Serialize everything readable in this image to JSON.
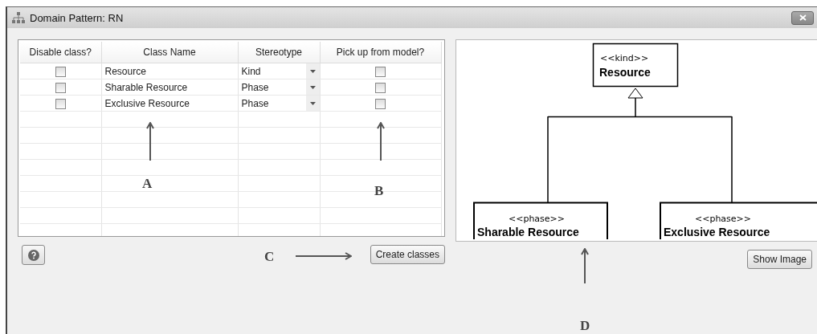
{
  "window": {
    "title": "Domain Pattern: RN"
  },
  "table": {
    "columns": [
      "Disable class?",
      "Class Name",
      "Stereotype",
      "Pick up from model?"
    ],
    "rows": [
      {
        "disable_class": false,
        "class_name": "Resource",
        "stereotype": "Kind",
        "pick_up": false
      },
      {
        "disable_class": false,
        "class_name": "Sharable Resource",
        "stereotype": "Phase",
        "pick_up": false
      },
      {
        "disable_class": false,
        "class_name": "Exclusive Resource",
        "stereotype": "Phase",
        "pick_up": false
      }
    ]
  },
  "buttons": {
    "create": "Create classes",
    "show_image": "Show Image"
  },
  "diagram": {
    "parent": {
      "stereotype": "<<kind>>",
      "name": "Resource"
    },
    "children": [
      {
        "stereotype": "<<phase>>",
        "name": "Sharable Resource"
      },
      {
        "stereotype": "<<phase>>",
        "name": "Exclusive Resource"
      }
    ]
  },
  "annotations": [
    "A",
    "B",
    "C",
    "D"
  ]
}
